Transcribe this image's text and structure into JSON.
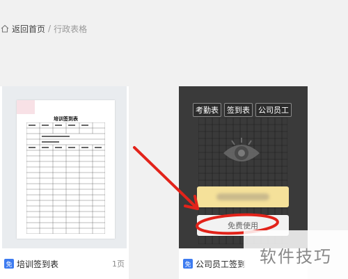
{
  "breadcrumb": {
    "home_label": "返回首页",
    "separator": "/",
    "current": "行政表格"
  },
  "cards": [
    {
      "doc_title": "培训签到表",
      "badge": "免",
      "name": "培训签到表",
      "pages": "1页"
    },
    {
      "tags": [
        "考勤表",
        "签到表",
        "公司员工"
      ],
      "use_button": "免费使用",
      "badge": "免",
      "name": "公司员工签到"
    }
  ],
  "watermark": "软件技巧",
  "colors": {
    "annotation_red": "#e2231a",
    "badge_blue": "#3d7bf0",
    "overlay_dark": "#3a3a3a",
    "highlight_yellow": "#f5e19a"
  }
}
